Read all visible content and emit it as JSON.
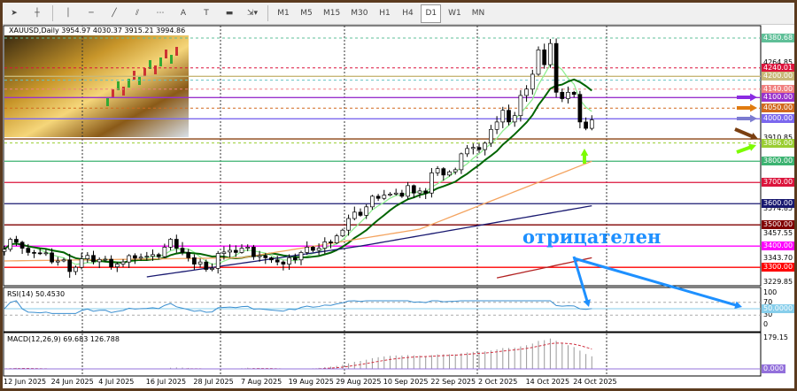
{
  "toolbar": {
    "tools": [
      {
        "name": "cursor",
        "glyph": "➤"
      },
      {
        "name": "crosshair",
        "glyph": "┼"
      },
      {
        "name": "vertical-line",
        "glyph": "│"
      },
      {
        "name": "horizontal-line",
        "glyph": "─"
      },
      {
        "name": "trend-line",
        "glyph": "╱"
      },
      {
        "name": "fibonacci",
        "glyph": "⫽"
      },
      {
        "name": "fibo-fan",
        "glyph": "⋯"
      },
      {
        "name": "text",
        "glyph": "A"
      },
      {
        "name": "text-label",
        "glyph": "T"
      },
      {
        "name": "rectangle",
        "glyph": "▬"
      },
      {
        "name": "arrows-dropdown",
        "glyph": "⇲▾"
      }
    ],
    "timeframes": [
      "M1",
      "M5",
      "M15",
      "M30",
      "H1",
      "H4",
      "D1",
      "W1",
      "MN"
    ],
    "active_timeframe": "D1"
  },
  "chart_title": "XAUUSD,Daily  3954.97 4030.37 3915.21 3994.86",
  "annotation_text": "отрицателен",
  "rsi_label": "RSI(14) 50.4530",
  "macd_label": "MACD(12,26,9) 69.683 126.788",
  "chart_data": {
    "type": "candlestick",
    "symbol": "XAUUSD",
    "timeframe": "Daily",
    "last_ohlc": [
      3954.97,
      4030.37,
      3915.21,
      3994.86
    ],
    "ylim": [
      3229.85,
      4380.68
    ],
    "closes": [
      3385,
      3432,
      3418,
      3390,
      3370,
      3368,
      3365,
      3368,
      3325,
      3330,
      3335,
      3280,
      3300,
      3340,
      3356,
      3326,
      3337,
      3338,
      3302,
      3315,
      3325,
      3355,
      3343,
      3348,
      3352,
      3360,
      3350,
      3395,
      3432,
      3390,
      3370,
      3345,
      3315,
      3325,
      3290,
      3295,
      3365,
      3372,
      3380,
      3370,
      3390,
      3395,
      3350,
      3355,
      3345,
      3335,
      3325,
      3315,
      3345,
      3335,
      3370,
      3395,
      3380,
      3390,
      3420,
      3415,
      3448,
      3475,
      3530,
      3560,
      3545,
      3585,
      3635,
      3625,
      3640,
      3645,
      3650,
      3635,
      3685,
      3650,
      3660,
      3650,
      3745,
      3765,
      3735,
      3750,
      3760,
      3835,
      3860,
      3865,
      3855,
      3885,
      3950,
      3985,
      4040,
      3985,
      4015,
      4110,
      4140,
      4210,
      4325,
      4255,
      4355,
      4125,
      4095,
      4125,
      4115,
      3985,
      3954.97,
      3994.86
    ],
    "x_ticks": [
      "12 Jun 2025",
      "24 Jun 2025",
      "4 Jul 2025",
      "16 Jul 2025",
      "28 Jul 2025",
      "7 Aug 2025",
      "19 Aug 2025",
      "29 Aug 2025",
      "10 Sep 2025",
      "22 Sep 2025",
      "2 Oct 2025",
      "14 Oct 2025",
      "24 Oct 2025"
    ],
    "price_scale_labels": [
      "4380.68",
      "4264.85",
      "3910.85",
      "3574.85",
      "3457.55",
      "3343.70",
      "3229.85"
    ],
    "levels": [
      {
        "price": 4380.68,
        "label": "4380.68",
        "color": "#5fbf98",
        "style": "dashed"
      },
      {
        "price": 4240.01,
        "label": "4240.01",
        "color": "#dc143c",
        "style": "dashed"
      },
      {
        "price": 4200.0,
        "label": "4200.00",
        "color": "#c8b878",
        "style": "solid"
      },
      {
        "price": 4182,
        "label": "",
        "color": "#66c2c2",
        "style": "dashed"
      },
      {
        "price": 4140.0,
        "label": "4140.00",
        "color": "#f08080",
        "style": "dashed"
      },
      {
        "price": 4100.0,
        "label": "4100.00",
        "color": "#9932cc",
        "style": "solid"
      },
      {
        "price": 4050.0,
        "label": "4050.00",
        "color": "#d2691e",
        "style": "dashed"
      },
      {
        "price": 4000.0,
        "label": "4000.00",
        "color": "#7b68ee",
        "style": "solid"
      },
      {
        "price": 3905,
        "label": "",
        "color": "#8b4513",
        "style": "solid"
      },
      {
        "price": 3886.0,
        "label": "3886.00",
        "color": "#9acd32",
        "style": "dashed"
      },
      {
        "price": 3800.0,
        "label": "3800.00",
        "color": "#3cb371",
        "style": "solid"
      },
      {
        "price": 3700.0,
        "label": "3700.00",
        "color": "#dc143c",
        "style": "solid"
      },
      {
        "price": 3600.0,
        "label": "3600.00",
        "color": "#191970",
        "style": "solid"
      },
      {
        "price": 3500.0,
        "label": "3500.00",
        "color": "#800000",
        "style": "solid"
      },
      {
        "price": 3400.0,
        "label": "3400.00",
        "color": "#ff00ff",
        "style": "solid"
      },
      {
        "price": 3300.0,
        "label": "3300.00",
        "color": "#ff0000",
        "style": "solid"
      }
    ],
    "moving_averages": [
      {
        "color": "#90ee90",
        "period": 5
      },
      {
        "color": "#006400",
        "period": 10
      },
      {
        "color": "#f4a460",
        "points": [
          [
            0,
            3330
          ],
          [
            40,
            3345
          ],
          [
            70,
            3480
          ],
          [
            99,
            3800
          ]
        ]
      },
      {
        "color": "#191970",
        "points": [
          [
            24,
            3255
          ],
          [
            60,
            3400
          ],
          [
            99,
            3590
          ]
        ]
      },
      {
        "color": "#b22222",
        "points": [
          [
            83,
            3250
          ],
          [
            99,
            3345
          ]
        ]
      }
    ],
    "rsi": {
      "period": 14,
      "levels": [
        100,
        70,
        50,
        30,
        0
      ],
      "current": "50.0000"
    },
    "macd": {
      "fast": 12,
      "slow": 26,
      "signal": 9,
      "scale_max": "179.15",
      "zero": "0.000"
    },
    "right_arrows": [
      {
        "color": "#8a2be2"
      },
      {
        "color": "#e07b10"
      },
      {
        "color": "#7b7bd0"
      },
      {
        "color": "#7a3f10"
      },
      {
        "color": "#7cfc00"
      }
    ]
  }
}
